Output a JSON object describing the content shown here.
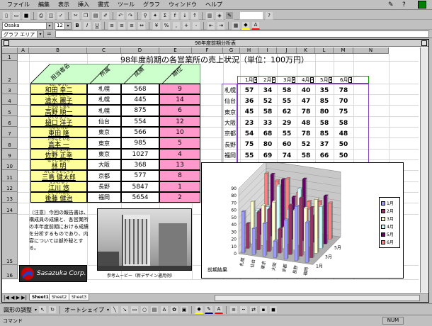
{
  "menubar": [
    "ファイル",
    "編集",
    "表示",
    "挿入",
    "書式",
    "ツール",
    "グラフ",
    "ウィンドウ",
    "ヘルプ"
  ],
  "font": {
    "name": "Osaka",
    "size": "12"
  },
  "namebox": "グラフ エリア",
  "window_title": "98年度前期分析表",
  "columns": [
    "A",
    "B",
    "C",
    "D",
    "E",
    "F",
    "G",
    "H",
    "I",
    "J",
    "K",
    "L",
    "M",
    "N"
  ],
  "rows": [
    "1",
    "2",
    "3",
    "4",
    "5",
    "6",
    "7",
    "8",
    "9",
    "10",
    "11",
    "12",
    "13",
    "14",
    "15",
    "16"
  ],
  "title": "98年度前期の各営業所の売上状況（単位：100万円）",
  "headers": {
    "name": "担当者名",
    "office": "所属",
    "sales": "成績",
    "rank": "順位"
  },
  "staff": [
    {
      "ruby": "わだ ゆうじ",
      "name": "和田 幸二",
      "office": "札幌",
      "sales": "568",
      "rank": "9"
    },
    {
      "ruby": "しみず れいこ",
      "name": "清水 麗子",
      "office": "札幌",
      "sales": "445",
      "rank": "14"
    },
    {
      "ruby": "たかの じゅん",
      "name": "高野 順一",
      "office": "札幌",
      "sales": "875",
      "rank": "6"
    },
    {
      "ruby": "ひぐち ようこ",
      "name": "樋口 洋子",
      "office": "仙台",
      "sales": "554",
      "rank": "12"
    },
    {
      "ruby": "ひがし けい",
      "name": "東田 隆",
      "office": "東京",
      "sales": "566",
      "rank": "10"
    },
    {
      "ruby": "たかもと いち",
      "name": "高本 一",
      "office": "東京",
      "sales": "985",
      "rank": "5"
    },
    {
      "ruby": "さとう まさお",
      "name": "佐野 正幸",
      "office": "東京",
      "sales": "1027",
      "rank": "4"
    },
    {
      "ruby": "はやし あきら",
      "name": "林 明",
      "office": "大阪",
      "sales": "368",
      "rank": "13"
    },
    {
      "ruby": "みしま ともじろう",
      "name": "三島 健太郎",
      "office": "京都",
      "sales": "577",
      "rank": "8"
    },
    {
      "ruby": "えがわ ゆう",
      "name": "江川 悠",
      "office": "長野",
      "sales": "5847",
      "rank": "1"
    },
    {
      "ruby": "ごとう けんじ",
      "name": "後藤 健治",
      "office": "福岡",
      "sales": "5654",
      "rank": "2"
    }
  ],
  "months": [
    "1月",
    "2月",
    "3月",
    "4月",
    "5月",
    "6月"
  ],
  "matrix": [
    {
      "city": "札幌",
      "v": [
        "57",
        "34",
        "58",
        "40",
        "35",
        "78"
      ]
    },
    {
      "city": "仙台",
      "v": [
        "36",
        "52",
        "55",
        "47",
        "85",
        "70"
      ]
    },
    {
      "city": "東京",
      "v": [
        "45",
        "58",
        "62",
        "78",
        "80",
        "75"
      ]
    },
    {
      "city": "大阪",
      "v": [
        "23",
        "33",
        "29",
        "48",
        "58",
        "58"
      ]
    },
    {
      "city": "京都",
      "v": [
        "54",
        "68",
        "55",
        "78",
        "85",
        "48"
      ]
    },
    {
      "city": "長野",
      "v": [
        "75",
        "80",
        "60",
        "52",
        "37",
        "50"
      ]
    },
    {
      "city": "福岡",
      "v": [
        "55",
        "69",
        "74",
        "58",
        "66",
        "50"
      ]
    }
  ],
  "note": "（注意）今回の報告書は、構成員の成績と、各営業所の本年度前期における成績を分析するものであり、内容については部外秘とする。",
  "photo_caption": "参考ムービー（新デザイン通用例）",
  "logo": "Sasazuka Corp.",
  "chart": {
    "caption": "前期結果",
    "yticks": [
      "0",
      "10",
      "20",
      "30",
      "40",
      "50",
      "60",
      "70",
      "80",
      "90"
    ],
    "zlabels": [
      "1月",
      "3月",
      "5月"
    ],
    "colors": [
      "#9999ff",
      "#993366",
      "#ffffcc",
      "#ccffff",
      "#660066",
      "#ff8080"
    ]
  },
  "chart_data": {
    "type": "bar",
    "categories": [
      "札幌",
      "仙台",
      "東京",
      "大阪",
      "京都",
      "長野",
      "福岡"
    ],
    "ylim": [
      0,
      90
    ],
    "series": [
      {
        "name": "1月",
        "values": [
          57,
          36,
          45,
          23,
          54,
          75,
          55
        ]
      },
      {
        "name": "2月",
        "values": [
          34,
          52,
          58,
          33,
          68,
          80,
          69
        ]
      },
      {
        "name": "3月",
        "values": [
          58,
          55,
          62,
          29,
          55,
          60,
          74
        ]
      },
      {
        "name": "4月",
        "values": [
          40,
          47,
          78,
          48,
          78,
          52,
          58
        ]
      },
      {
        "name": "5月",
        "values": [
          35,
          85,
          80,
          58,
          85,
          37,
          66
        ]
      },
      {
        "name": "6月",
        "values": [
          78,
          70,
          75,
          58,
          48,
          50,
          50
        ]
      }
    ]
  },
  "sheet_tabs": [
    "Sheet1",
    "Sheet2",
    "Sheet3"
  ],
  "drawbar": {
    "draw": "図形の調整",
    "autoshape": "オートシェイプ"
  },
  "status": {
    "left": "コマンド",
    "num": "NUM"
  }
}
